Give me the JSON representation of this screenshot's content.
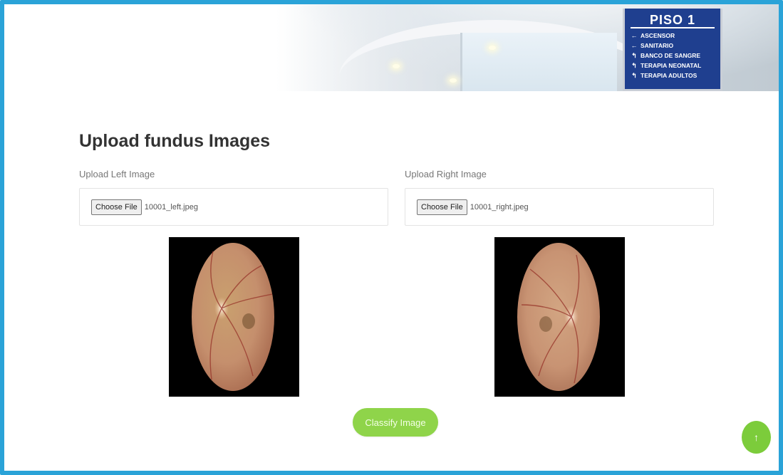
{
  "banner": {
    "sign": {
      "title": "PISO 1",
      "items": [
        {
          "arrow": "←",
          "label": "ASCENSOR"
        },
        {
          "arrow": "←",
          "label": "SANITARIO"
        },
        {
          "arrow": "↰",
          "label": "BANCO DE SANGRE"
        },
        {
          "arrow": "↰",
          "label": "TERAPIA NEONATAL"
        },
        {
          "arrow": "↰",
          "label": "TERAPIA ADULTOS"
        }
      ]
    }
  },
  "main": {
    "title": "Upload fundus Images",
    "left": {
      "label": "Upload Left Image",
      "button_label": "Choose File",
      "file_name": "10001_left.jpeg"
    },
    "right": {
      "label": "Upload Right Image",
      "button_label": "Choose File",
      "file_name": "10001_right.jpeg"
    },
    "classify_label": "Classify Image",
    "scroll_top_icon": "↑"
  },
  "colors": {
    "frame": "#2aa3d8",
    "accent_green": "#8fd44a",
    "sign_blue": "#1f3f8f"
  }
}
